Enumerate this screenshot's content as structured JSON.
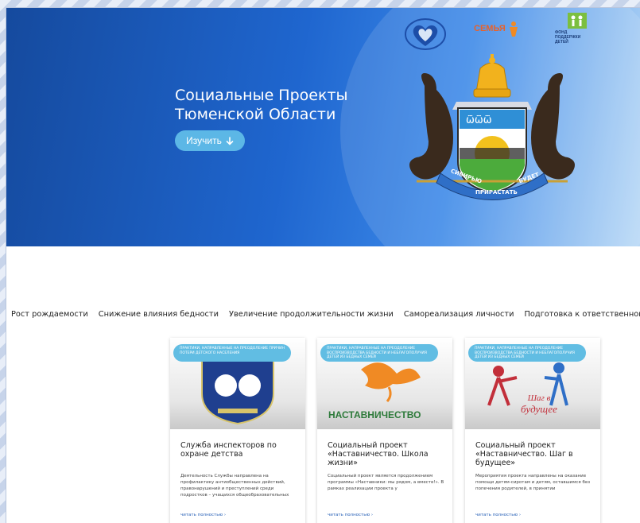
{
  "hero": {
    "title_line1": "Социальные Проекты",
    "title_line2": "Тюменской Области",
    "explore_label": "Изучить",
    "logos": {
      "semya": "СЕМЬЯ",
      "fond_line1": "ФОНД",
      "fond_line2": "ПОДДЕРЖКИ",
      "fond_line3": "ДЕТЕЙ"
    },
    "coat_of_arms": {
      "motto_1": "СИБИРЬЮ",
      "motto_2": "ПРИРАСТАТЬ",
      "motto_3": "БУДЕТ"
    }
  },
  "tabs": [
    {
      "label": "Рост рождаемости"
    },
    {
      "label": "Снижение влияния бедности"
    },
    {
      "label": "Увеличение продолжительности жизни"
    },
    {
      "label": "Самореализация личности"
    },
    {
      "label": "Подготовка к ответственному родительству"
    }
  ],
  "cards": [
    {
      "tag": "ПРАКТИКИ, НАПРАВЛЕННЫЕ НА ПРЕОДОЛЕНИЕ ПРИЧИН ПОТЕРИ ДЕТСКОГО НАСЕЛЕНИЯ",
      "title": "Служба инспекторов по охране детства",
      "desc": "Деятельность Службы направлена на профилактику антиобщественных действий, правонарушений и преступлений среди подростков – учащихся общеобразовательных",
      "more": "читать полностью ›",
      "image_caption": ""
    },
    {
      "tag": "ПРАКТИКИ, НАПРАВЛЕННЫЕ НА ПРЕОДОЛЕНИЕ ВОСПРОИЗВОДСТВА БЕДНОСТИ И НЕБЛАГОПОЛУЧИЯ ДЕТЕЙ ИЗ БЕДНЫХ СЕМЕЙ",
      "title": "Социальный проект «Наставничество. Школа жизни»",
      "desc": "Социальный проект является продолжением программы «Наставники: мы рядом, а вместе!». В рамках реализации проекта у",
      "more": "читать полностью ›",
      "image_caption": "НАСТАВНИЧЕСТВО"
    },
    {
      "tag": "ПРАКТИКИ, НАПРАВЛЕННЫЕ НА ПРЕОДОЛЕНИЕ ВОСПРОИЗВОДСТВА БЕДНОСТИ И НЕБЛАГОПОЛУЧИЯ ДЕТЕЙ ИЗ БЕДНЫХ СЕМЕЙ",
      "title": "Социальный проект «Наставничество. Шаг в будущее»",
      "desc": "Мероприятия проекта направлены на оказание помощи детям-сиротам и детям, оставшимся без попечения родителей, в принятии",
      "more": "читать полностью ›",
      "image_caption_1": "Шаг в",
      "image_caption_2": "будущее"
    }
  ]
}
